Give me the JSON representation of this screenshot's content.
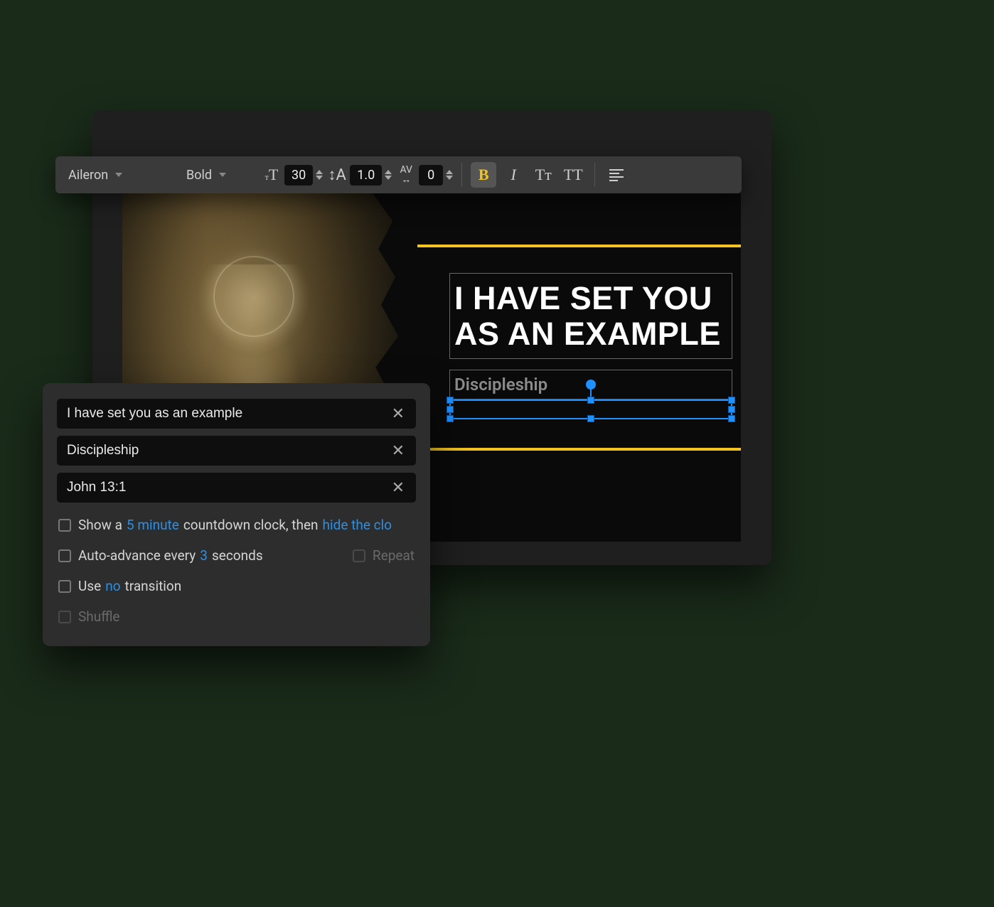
{
  "toolbar": {
    "font_family": "Aileron",
    "font_weight": "Bold",
    "font_size": "30",
    "line_height": "1.0",
    "tracking": "0",
    "bold_active": true,
    "bold_label": "B",
    "italic_label": "I",
    "case1_label": "Tᴛ",
    "case2_label": "TT"
  },
  "slide": {
    "title": "I HAVE SET YOU AS AN EXAMPLE",
    "subtitle": "Discipleship"
  },
  "panel": {
    "fields": [
      "I have set you as an example",
      "Discipleship",
      "John 13:1"
    ],
    "countdown": {
      "prefix": "Show a",
      "value": "5 minute",
      "mid": "countdown clock, then",
      "action": "hide the clo"
    },
    "autoadvance": {
      "prefix": "Auto-advance every",
      "value": "3",
      "suffix": "seconds",
      "repeat_label": "Repeat"
    },
    "transition": {
      "prefix": "Use",
      "value": "no",
      "suffix": "transition"
    },
    "shuffle_label": "Shuffle"
  }
}
